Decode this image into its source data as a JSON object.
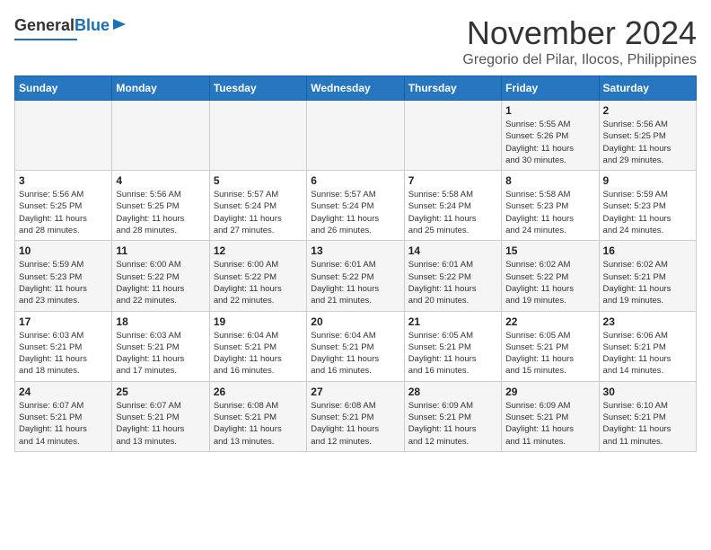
{
  "header": {
    "logo_line1": "General",
    "logo_line2": "Blue",
    "month": "November 2024",
    "location": "Gregorio del Pilar, Ilocos, Philippines"
  },
  "weekdays": [
    "Sunday",
    "Monday",
    "Tuesday",
    "Wednesday",
    "Thursday",
    "Friday",
    "Saturday"
  ],
  "weeks": [
    [
      {
        "day": "",
        "info": ""
      },
      {
        "day": "",
        "info": ""
      },
      {
        "day": "",
        "info": ""
      },
      {
        "day": "",
        "info": ""
      },
      {
        "day": "",
        "info": ""
      },
      {
        "day": "1",
        "info": "Sunrise: 5:55 AM\nSunset: 5:26 PM\nDaylight: 11 hours\nand 30 minutes."
      },
      {
        "day": "2",
        "info": "Sunrise: 5:56 AM\nSunset: 5:25 PM\nDaylight: 11 hours\nand 29 minutes."
      }
    ],
    [
      {
        "day": "3",
        "info": "Sunrise: 5:56 AM\nSunset: 5:25 PM\nDaylight: 11 hours\nand 28 minutes."
      },
      {
        "day": "4",
        "info": "Sunrise: 5:56 AM\nSunset: 5:25 PM\nDaylight: 11 hours\nand 28 minutes."
      },
      {
        "day": "5",
        "info": "Sunrise: 5:57 AM\nSunset: 5:24 PM\nDaylight: 11 hours\nand 27 minutes."
      },
      {
        "day": "6",
        "info": "Sunrise: 5:57 AM\nSunset: 5:24 PM\nDaylight: 11 hours\nand 26 minutes."
      },
      {
        "day": "7",
        "info": "Sunrise: 5:58 AM\nSunset: 5:24 PM\nDaylight: 11 hours\nand 25 minutes."
      },
      {
        "day": "8",
        "info": "Sunrise: 5:58 AM\nSunset: 5:23 PM\nDaylight: 11 hours\nand 24 minutes."
      },
      {
        "day": "9",
        "info": "Sunrise: 5:59 AM\nSunset: 5:23 PM\nDaylight: 11 hours\nand 24 minutes."
      }
    ],
    [
      {
        "day": "10",
        "info": "Sunrise: 5:59 AM\nSunset: 5:23 PM\nDaylight: 11 hours\nand 23 minutes."
      },
      {
        "day": "11",
        "info": "Sunrise: 6:00 AM\nSunset: 5:22 PM\nDaylight: 11 hours\nand 22 minutes."
      },
      {
        "day": "12",
        "info": "Sunrise: 6:00 AM\nSunset: 5:22 PM\nDaylight: 11 hours\nand 22 minutes."
      },
      {
        "day": "13",
        "info": "Sunrise: 6:01 AM\nSunset: 5:22 PM\nDaylight: 11 hours\nand 21 minutes."
      },
      {
        "day": "14",
        "info": "Sunrise: 6:01 AM\nSunset: 5:22 PM\nDaylight: 11 hours\nand 20 minutes."
      },
      {
        "day": "15",
        "info": "Sunrise: 6:02 AM\nSunset: 5:22 PM\nDaylight: 11 hours\nand 19 minutes."
      },
      {
        "day": "16",
        "info": "Sunrise: 6:02 AM\nSunset: 5:21 PM\nDaylight: 11 hours\nand 19 minutes."
      }
    ],
    [
      {
        "day": "17",
        "info": "Sunrise: 6:03 AM\nSunset: 5:21 PM\nDaylight: 11 hours\nand 18 minutes."
      },
      {
        "day": "18",
        "info": "Sunrise: 6:03 AM\nSunset: 5:21 PM\nDaylight: 11 hours\nand 17 minutes."
      },
      {
        "day": "19",
        "info": "Sunrise: 6:04 AM\nSunset: 5:21 PM\nDaylight: 11 hours\nand 16 minutes."
      },
      {
        "day": "20",
        "info": "Sunrise: 6:04 AM\nSunset: 5:21 PM\nDaylight: 11 hours\nand 16 minutes."
      },
      {
        "day": "21",
        "info": "Sunrise: 6:05 AM\nSunset: 5:21 PM\nDaylight: 11 hours\nand 16 minutes."
      },
      {
        "day": "22",
        "info": "Sunrise: 6:05 AM\nSunset: 5:21 PM\nDaylight: 11 hours\nand 15 minutes."
      },
      {
        "day": "23",
        "info": "Sunrise: 6:06 AM\nSunset: 5:21 PM\nDaylight: 11 hours\nand 14 minutes."
      }
    ],
    [
      {
        "day": "24",
        "info": "Sunrise: 6:07 AM\nSunset: 5:21 PM\nDaylight: 11 hours\nand 14 minutes."
      },
      {
        "day": "25",
        "info": "Sunrise: 6:07 AM\nSunset: 5:21 PM\nDaylight: 11 hours\nand 13 minutes."
      },
      {
        "day": "26",
        "info": "Sunrise: 6:08 AM\nSunset: 5:21 PM\nDaylight: 11 hours\nand 13 minutes."
      },
      {
        "day": "27",
        "info": "Sunrise: 6:08 AM\nSunset: 5:21 PM\nDaylight: 11 hours\nand 12 minutes."
      },
      {
        "day": "28",
        "info": "Sunrise: 6:09 AM\nSunset: 5:21 PM\nDaylight: 11 hours\nand 12 minutes."
      },
      {
        "day": "29",
        "info": "Sunrise: 6:09 AM\nSunset: 5:21 PM\nDaylight: 11 hours\nand 11 minutes."
      },
      {
        "day": "30",
        "info": "Sunrise: 6:10 AM\nSunset: 5:21 PM\nDaylight: 11 hours\nand 11 minutes."
      }
    ]
  ]
}
